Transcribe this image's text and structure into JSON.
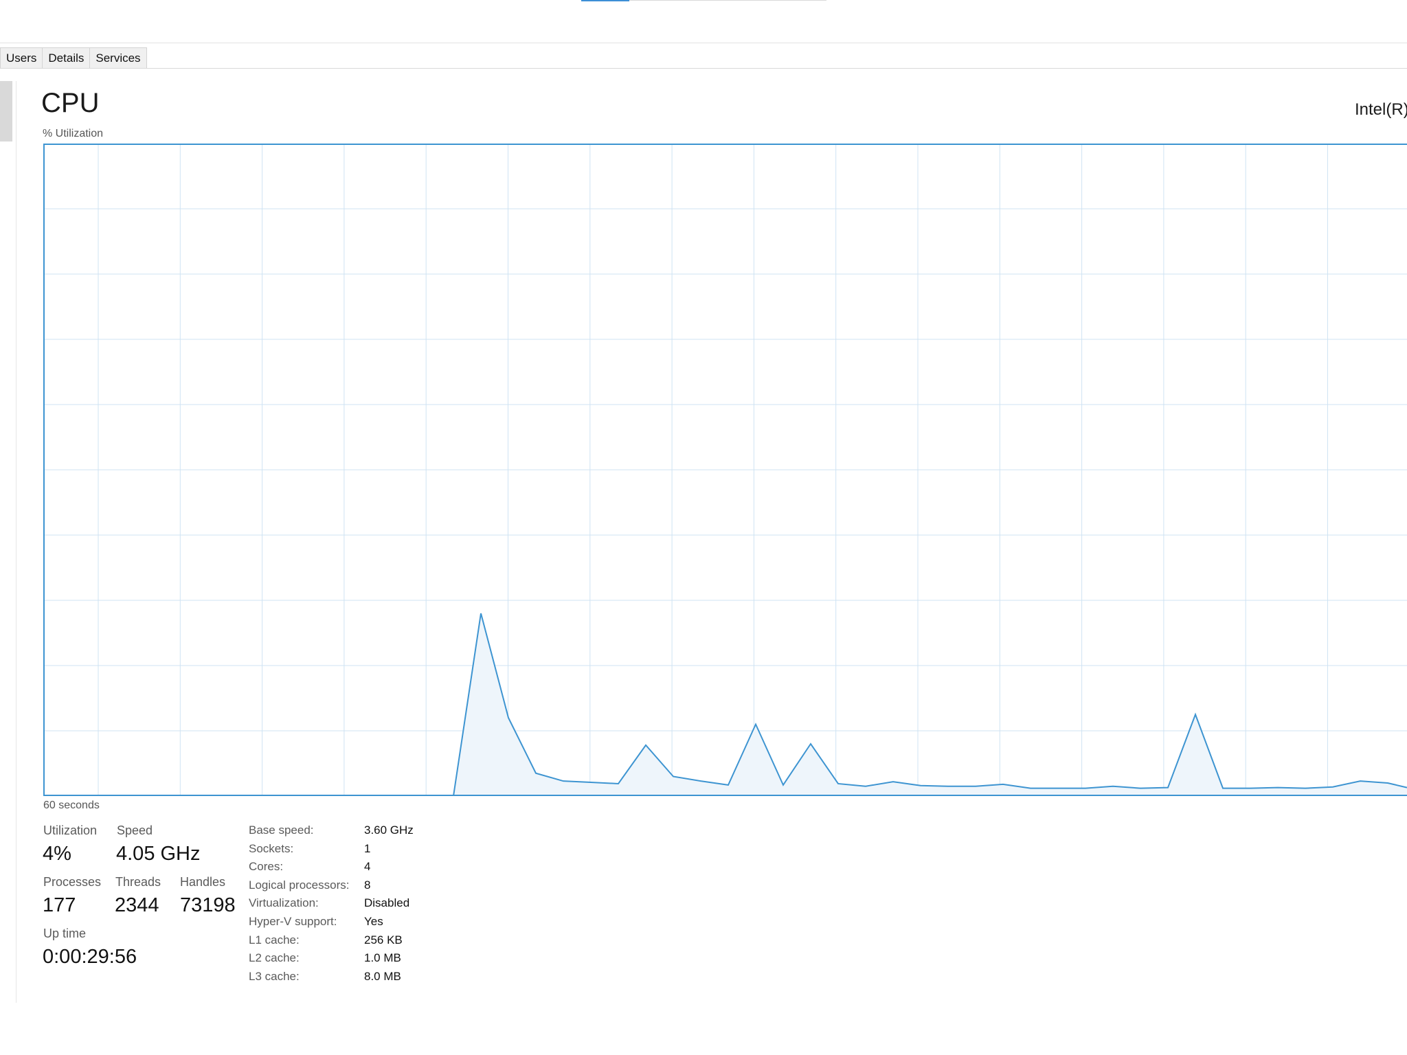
{
  "tabs": [
    "Users",
    "Details",
    "Services"
  ],
  "header": {
    "title": "CPU",
    "cpu_model": "Intel(R)",
    "util_label": "% Utilization",
    "seconds_label": "60 seconds"
  },
  "colors": {
    "graph_line": "#3d94d1",
    "graph_fill": "#eef5fb",
    "grid": "#cfe3f3",
    "border": "#3d94d1"
  },
  "stats": {
    "utilization": {
      "label": "Utilization",
      "value": "4%"
    },
    "speed": {
      "label": "Speed",
      "value": "4.05 GHz"
    },
    "processes": {
      "label": "Processes",
      "value": "177"
    },
    "threads": {
      "label": "Threads",
      "value": "2344"
    },
    "handles": {
      "label": "Handles",
      "value": "73198"
    },
    "uptime": {
      "label": "Up time",
      "value": "0:00:29:56"
    }
  },
  "specs": [
    {
      "key": "Base speed:",
      "value": "3.60 GHz"
    },
    {
      "key": "Sockets:",
      "value": "1"
    },
    {
      "key": "Cores:",
      "value": "4"
    },
    {
      "key": "Logical processors:",
      "value": "8"
    },
    {
      "key": "Virtualization:",
      "value": "Disabled"
    },
    {
      "key": "Hyper-V support:",
      "value": "Yes"
    },
    {
      "key": "L1 cache:",
      "value": "256 KB"
    },
    {
      "key": "L2 cache:",
      "value": "1.0 MB"
    },
    {
      "key": "L3 cache:",
      "value": "8.0 MB"
    }
  ],
  "chart_data": {
    "type": "area",
    "ylim": [
      0,
      100
    ],
    "x": [
      0,
      1,
      2,
      3,
      4,
      5,
      6,
      7,
      8,
      9,
      10,
      11,
      12,
      13,
      14,
      15,
      16,
      17,
      18,
      19,
      20,
      21,
      22,
      23,
      24,
      25,
      26,
      27,
      28,
      29,
      30,
      31,
      32,
      33,
      34,
      35,
      36,
      37,
      38,
      39,
      40,
      41,
      42,
      43,
      44,
      45,
      46,
      47,
      48,
      49,
      50
    ],
    "values": [
      0,
      0,
      0,
      0,
      0,
      0,
      0,
      0,
      0,
      0,
      0,
      0,
      0,
      0,
      0,
      0,
      28,
      12,
      3.5,
      2.3,
      2.1,
      1.9,
      7.8,
      3,
      2.3,
      1.7,
      11,
      1.7,
      8,
      1.9,
      1.5,
      2.2,
      1.6,
      1.5,
      1.5,
      1.8,
      1.2,
      1.2,
      1.2,
      1.5,
      1.2,
      1.3,
      12.5,
      1.2,
      1.2,
      1.3,
      1.2,
      1.4,
      2.3,
      2,
      1.3
    ]
  }
}
